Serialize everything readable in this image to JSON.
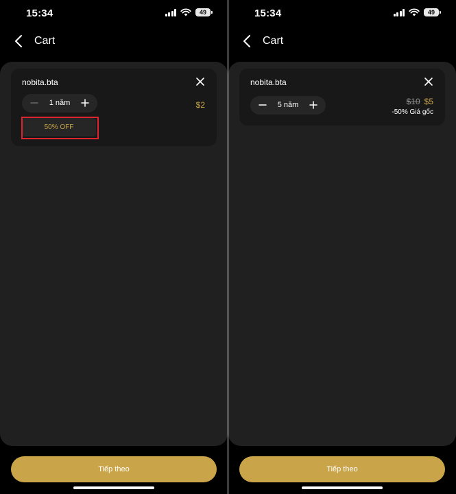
{
  "status": {
    "time": "15:34",
    "battery": "49"
  },
  "nav": {
    "title": "Cart"
  },
  "left": {
    "item_name": "nobita.bta",
    "quantity": "1 năm",
    "price": "$2",
    "discount": "50% OFF",
    "continue_label": "Tiếp theo"
  },
  "right": {
    "item_name": "nobita.bta",
    "quantity": "5 năm",
    "old_price": "$10",
    "new_price": "$5",
    "price_note": "-50% Giá gốc",
    "continue_label": "Tiếp theo"
  },
  "colors": {
    "accent": "#c9a449",
    "background": "#000000",
    "sheet": "#202020",
    "card": "#181818",
    "highlight": "#e0242e"
  },
  "icons": [
    "signal-icon",
    "wifi-icon",
    "battery-icon",
    "chevron-left-icon",
    "close-icon",
    "minus-icon",
    "plus-icon"
  ]
}
